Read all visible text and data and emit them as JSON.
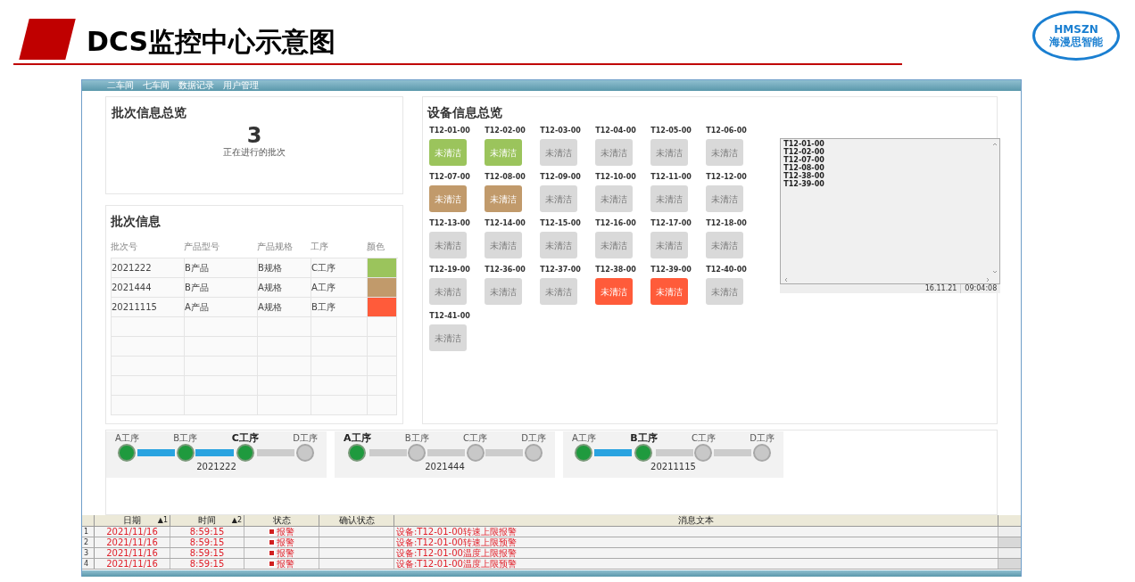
{
  "slide": {
    "title": "DCS监控中心示意图",
    "logo": {
      "brand": "HMSZN",
      "name": "海漫思智能"
    }
  },
  "menu": [
    {
      "label": "二车间"
    },
    {
      "label": "七车间"
    },
    {
      "label": "数据记录"
    },
    {
      "label": "用户管理"
    }
  ],
  "batch_overview": {
    "title": "批次信息总览",
    "count": "3",
    "caption": "正在进行的批次"
  },
  "batch_table": {
    "title": "批次信息",
    "columns": [
      "批次号",
      "产品型号",
      "产品规格",
      "工序",
      "颜色"
    ],
    "rows": [
      {
        "batch": "2021222",
        "product": "B产品",
        "spec": "B规格",
        "process": "C工序",
        "color": "#9bc45c"
      },
      {
        "batch": "2021444",
        "product": "B产品",
        "spec": "A规格",
        "process": "A工序",
        "color": "#c19a6b"
      },
      {
        "batch": "20211115",
        "product": "A产品",
        "spec": "A规格",
        "process": "B工序",
        "color": "#ff5b3a"
      }
    ]
  },
  "devices": {
    "title": "设备信息总览",
    "items": [
      {
        "id": "T12-01-00",
        "status": "未清洁",
        "color": "#9bc45c"
      },
      {
        "id": "T12-02-00",
        "status": "未清洁",
        "color": "#9bc45c"
      },
      {
        "id": "T12-03-00",
        "status": "未清洁",
        "color": "#d9d9d9"
      },
      {
        "id": "T12-04-00",
        "status": "未清洁",
        "color": "#d9d9d9"
      },
      {
        "id": "T12-05-00",
        "status": "未清洁",
        "color": "#d9d9d9"
      },
      {
        "id": "T12-06-00",
        "status": "未清洁",
        "color": "#d9d9d9"
      },
      {
        "id": "T12-07-00",
        "status": "未清洁",
        "color": "#c19a6b"
      },
      {
        "id": "T12-08-00",
        "status": "未清洁",
        "color": "#c19a6b"
      },
      {
        "id": "T12-09-00",
        "status": "未清洁",
        "color": "#d9d9d9"
      },
      {
        "id": "T12-10-00",
        "status": "未清洁",
        "color": "#d9d9d9"
      },
      {
        "id": "T12-11-00",
        "status": "未清洁",
        "color": "#d9d9d9"
      },
      {
        "id": "T12-12-00",
        "status": "未清洁",
        "color": "#d9d9d9"
      },
      {
        "id": "T12-13-00",
        "status": "未清洁",
        "color": "#d9d9d9"
      },
      {
        "id": "T12-14-00",
        "status": "未清洁",
        "color": "#d9d9d9"
      },
      {
        "id": "T12-15-00",
        "status": "未清洁",
        "color": "#d9d9d9"
      },
      {
        "id": "T12-16-00",
        "status": "未清洁",
        "color": "#d9d9d9"
      },
      {
        "id": "T12-17-00",
        "status": "未清洁",
        "color": "#d9d9d9"
      },
      {
        "id": "T12-18-00",
        "status": "未清洁",
        "color": "#d9d9d9"
      },
      {
        "id": "T12-19-00",
        "status": "未清洁",
        "color": "#d9d9d9"
      },
      {
        "id": "T12-36-00",
        "status": "未清洁",
        "color": "#d9d9d9"
      },
      {
        "id": "T12-37-00",
        "status": "未清洁",
        "color": "#d9d9d9"
      },
      {
        "id": "T12-38-00",
        "status": "未清洁",
        "color": "#ff5b3a"
      },
      {
        "id": "T12-39-00",
        "status": "未清洁",
        "color": "#ff5b3a"
      },
      {
        "id": "T12-40-00",
        "status": "未清洁",
        "color": "#d9d9d9"
      },
      {
        "id": "T12-41-00",
        "status": "未清洁",
        "color": "#d9d9d9"
      }
    ]
  },
  "device_log": {
    "lines": [
      "T12-01-00",
      "T12-02-00",
      "T12-07-00",
      "T12-08-00",
      "T12-38-00",
      "T12-39-00"
    ],
    "date": "16.11.21",
    "time": "09:04:08"
  },
  "process_flows": [
    {
      "batch": "2021222",
      "steps": [
        {
          "label": "A工序",
          "done": true,
          "current": false
        },
        {
          "label": "B工序",
          "done": true,
          "current": false
        },
        {
          "label": "C工序",
          "done": true,
          "current": true
        },
        {
          "label": "D工序",
          "done": false,
          "current": false
        }
      ]
    },
    {
      "batch": "2021444",
      "steps": [
        {
          "label": "A工序",
          "done": true,
          "current": true
        },
        {
          "label": "B工序",
          "done": false,
          "current": false
        },
        {
          "label": "C工序",
          "done": false,
          "current": false
        },
        {
          "label": "D工序",
          "done": false,
          "current": false
        }
      ]
    },
    {
      "batch": "20211115",
      "steps": [
        {
          "label": "A工序",
          "done": true,
          "current": false
        },
        {
          "label": "B工序",
          "done": true,
          "current": true
        },
        {
          "label": "C工序",
          "done": false,
          "current": false
        },
        {
          "label": "D工序",
          "done": false,
          "current": false
        }
      ]
    }
  ],
  "alarm_table": {
    "columns": [
      {
        "label": "日期",
        "sort": "▲1"
      },
      {
        "label": "时间",
        "sort": "▲2"
      },
      {
        "label": "状态"
      },
      {
        "label": "确认状态"
      },
      {
        "label": "消息文本"
      }
    ],
    "rows": [
      {
        "index": "1",
        "date": "2021/11/16",
        "time": "8:59:15",
        "status": "报警",
        "message": "设备:T12-01-00转速上限报警"
      },
      {
        "index": "2",
        "date": "2021/11/16",
        "time": "8:59:15",
        "status": "报警",
        "message": "设备:T12-01-00转速上限预警"
      },
      {
        "index": "3",
        "date": "2021/11/16",
        "time": "8:59:15",
        "status": "报警",
        "message": "设备:T12-01-00温度上限报警"
      },
      {
        "index": "4",
        "date": "2021/11/16",
        "time": "8:59:15",
        "status": "报警",
        "message": "设备:T12-01-00温度上限预警"
      }
    ]
  }
}
